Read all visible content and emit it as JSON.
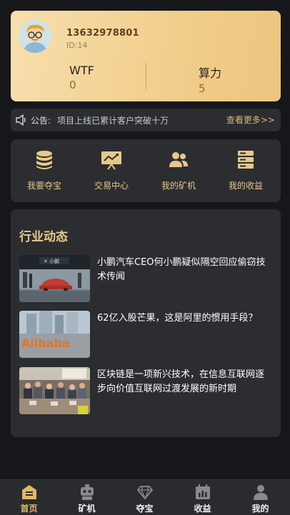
{
  "user": {
    "phone": "13632978801",
    "id_text": "ID:14",
    "stats": [
      {
        "label": "WTF",
        "value": "0"
      },
      {
        "label": "算力",
        "value": "5"
      }
    ]
  },
  "notice": {
    "tag": "公告:",
    "text": "项目上线已累计客户突破十万",
    "more": "查看更多>>"
  },
  "menu": [
    {
      "label": "我要夺宝",
      "icon": "coins-stack-icon"
    },
    {
      "label": "交易中心",
      "icon": "trading-chart-icon"
    },
    {
      "label": "我的矿机",
      "icon": "users-icon"
    },
    {
      "label": "我的收益",
      "icon": "server-icon"
    }
  ],
  "news": {
    "title": "行业动态",
    "items": [
      {
        "headline": "小鹏汽车CEO何小鹏疑似隔空回应偷窃技术传闻",
        "thumb": "car-showroom-photo"
      },
      {
        "headline": "62亿入股芒果，这是阿里的惯用手段？",
        "thumb": "alibaba-sign-photo",
        "thumb_text": "Alibaba"
      },
      {
        "headline": "区块链是一项新兴技术，在信息互联网逐步向价值互联网过渡发展的新时期",
        "thumb": "conference-room-photo"
      }
    ]
  },
  "tabs": [
    {
      "label": "首页",
      "icon": "home-icon",
      "active": true
    },
    {
      "label": "矿机",
      "icon": "robot-icon",
      "active": false
    },
    {
      "label": "夺宝",
      "icon": "diamond-icon",
      "active": false
    },
    {
      "label": "收益",
      "icon": "calendar-chart-icon",
      "active": false
    },
    {
      "label": "我的",
      "icon": "person-icon",
      "active": false
    }
  ],
  "colors": {
    "accent": "#e8c98a",
    "card_gradient_start": "#f7dfae",
    "card_gradient_end": "#ecc57f",
    "background": "#16171b",
    "panel": "#2c2d31"
  }
}
